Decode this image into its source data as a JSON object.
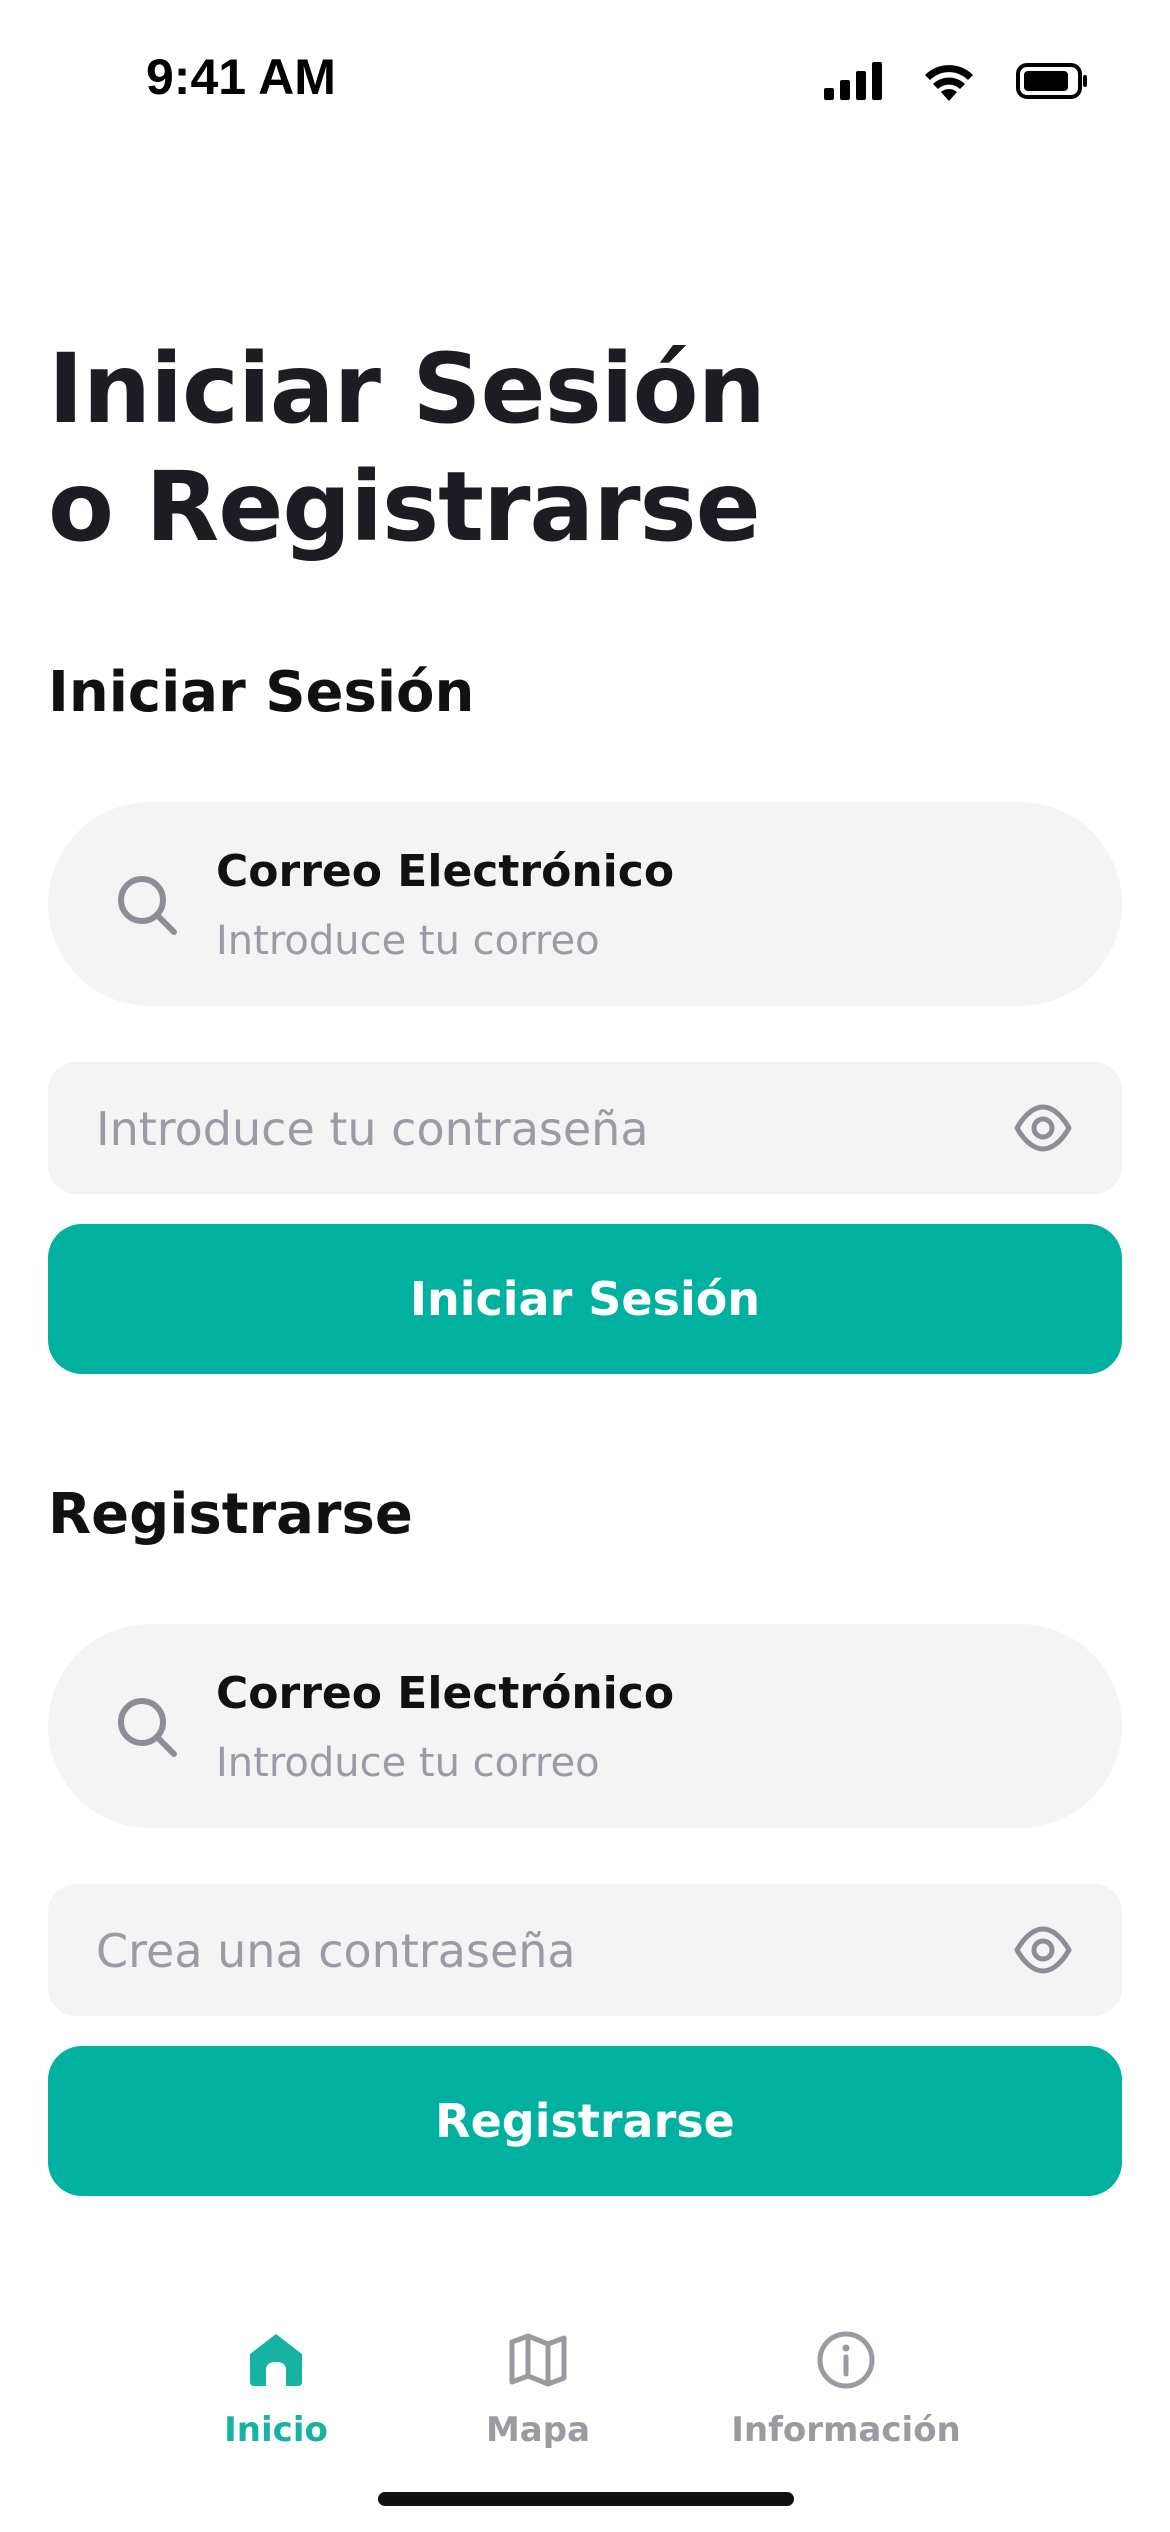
{
  "status_bar": {
    "time": "9:41 AM"
  },
  "page": {
    "title_line1": "Iniciar Sesión",
    "title_line2": "o Registrarse"
  },
  "login": {
    "section_title": "Iniciar Sesión",
    "email_label": "Correo Electrónico",
    "email_placeholder": "Introduce tu correo",
    "password_placeholder": "Introduce tu contraseña",
    "button_label": "Iniciar Sesión"
  },
  "register": {
    "section_title": "Registrarse",
    "email_label": "Correo Electrónico",
    "email_placeholder": "Introduce tu correo",
    "password_placeholder": "Crea una contraseña",
    "button_label": "Registrarse"
  },
  "tab_bar": {
    "tabs": [
      {
        "label": "Inicio",
        "icon": "home-icon",
        "active": true
      },
      {
        "label": "Mapa",
        "icon": "map-icon",
        "active": false
      },
      {
        "label": "Información",
        "icon": "info-icon",
        "active": false
      }
    ]
  },
  "colors": {
    "accent": "#00b19f",
    "field_bg": "#f4f4f5",
    "placeholder": "#9b9ba5"
  }
}
